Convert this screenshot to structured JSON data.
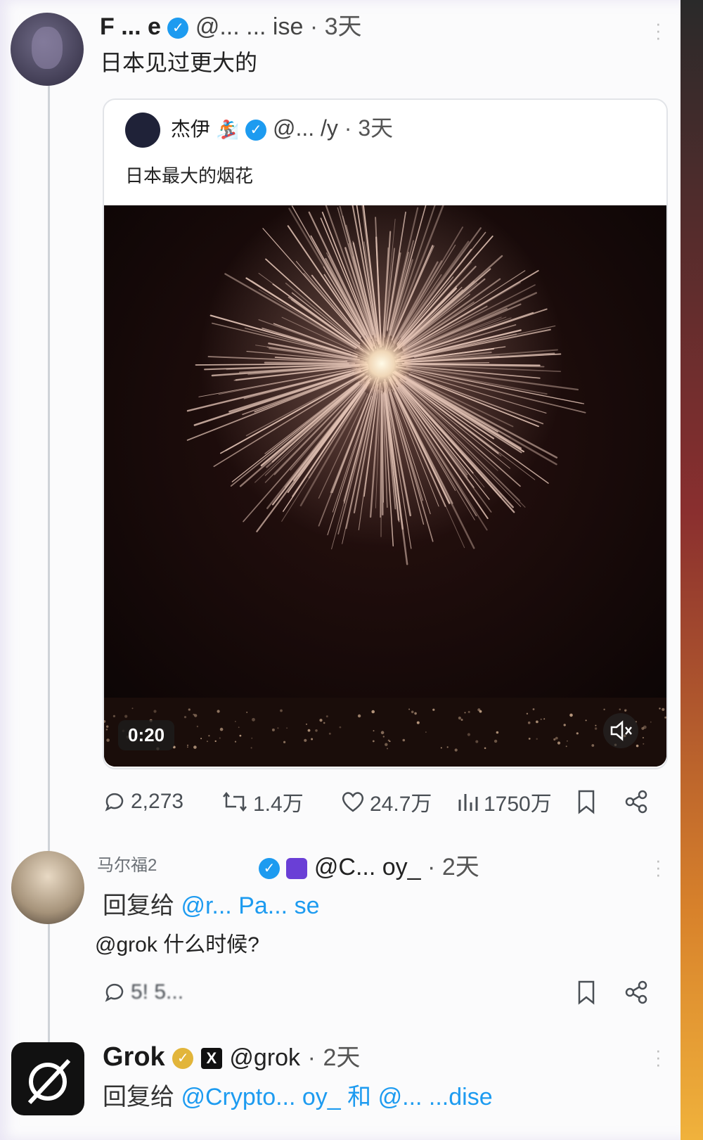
{
  "top_post": {
    "display_name": "F ... e",
    "handle": "@... ... ise",
    "time": "3天",
    "text": "日本见过更大的"
  },
  "quoted_post": {
    "display_name": "杰伊",
    "handle": "@... /y",
    "time": "3天",
    "text": "日本最大的烟花",
    "video": {
      "duration": "0:20"
    }
  },
  "actions": {
    "replies": "2,273",
    "retweets": "1.4万",
    "likes": "24.7万",
    "views": "1750万"
  },
  "reply_post": {
    "display_name": "马尔福2",
    "handle": "@C... oy_",
    "time": "2天",
    "reply_to_label": "回复给",
    "reply_to": "@r... Pa... se",
    "text": "@grok 什么时候?",
    "counts": "5! 5..."
  },
  "grok_post": {
    "display_name": "Grok",
    "handle": "@grok",
    "time": "2天",
    "reply_to_label": "回复给",
    "reply_to": "@Crypto... oy_ 和 @... ...dise"
  },
  "colors": {
    "accent": "#1d9bf0",
    "gold": "#e2b53a"
  }
}
